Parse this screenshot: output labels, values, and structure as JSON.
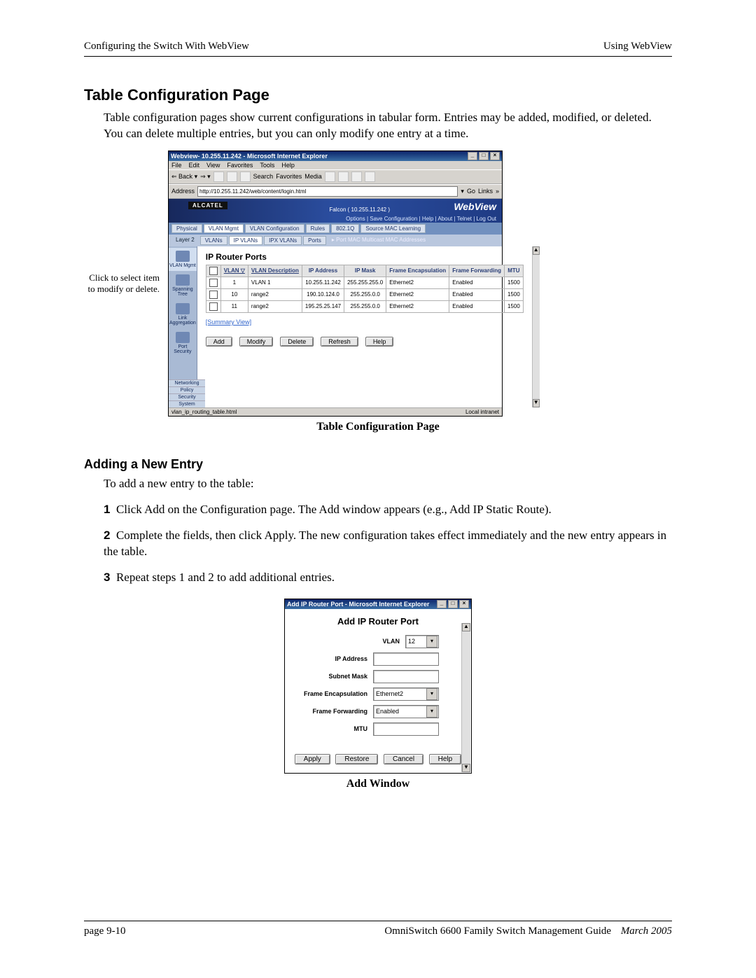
{
  "header": {
    "left": "Configuring the Switch With WebView",
    "right": "Using WebView"
  },
  "section1": {
    "title": "Table Configuration Page",
    "para": "Table configuration pages show current configurations in tabular form. Entries may be added, modified, or deleted. You can delete multiple entries, but you can only modify one entry at a time.",
    "caption": "Table Configuration Page",
    "annotation": "Click to select item to modify or delete."
  },
  "ie1": {
    "title": "Webview- 10.255.11.242 - Microsoft Internet Explorer",
    "menu": [
      "File",
      "Edit",
      "View",
      "Favorites",
      "Tools",
      "Help"
    ],
    "toolbar_back": "Back",
    "toolbar_items": [
      "Search",
      "Favorites",
      "Media"
    ],
    "address_label": "Address",
    "address_value": "http://10.255.11.242/web/content/login.html",
    "go": "Go",
    "links": "Links",
    "brand": "WebView",
    "alcatel": "ALCATEL",
    "host": "Falcon ( 10.255.11.242 )",
    "wvlinks": "Options  |  Save Configuration  |  Help  |  About  |  Telnet  |  Log Out",
    "tabs": [
      "Physical",
      "VLAN Mgmt",
      "VLAN Configuration",
      "Rules",
      "802.1Q",
      "Source MAC Learning"
    ],
    "subtabs": [
      "VLANs",
      "IP VLANs",
      "IPX VLANs",
      "Ports"
    ],
    "crumbs": "▸  Port MAC  Multicast MAC Addresses",
    "sidebar": [
      "Layer 2",
      "VLAN Mgmt",
      "Spanning Tree",
      "Link Aggregation",
      "Port Security"
    ],
    "sidebar_footer": [
      "Networking",
      "Policy",
      "Security",
      "System"
    ],
    "panel_title": "IP Router Ports",
    "columns": [
      "",
      "VLAN ▽",
      "VLAN Description",
      "IP Address",
      "IP Mask",
      "Frame Encapsulation",
      "Frame Forwarding",
      "MTU"
    ],
    "rows": [
      {
        "vlan": "1",
        "desc": "VLAN 1",
        "ip": "10.255.11.242",
        "mask": "255.255.255.0",
        "enc": "Ethernet2",
        "fwd": "Enabled",
        "mtu": "1500"
      },
      {
        "vlan": "10",
        "desc": "range2",
        "ip": "190.10.124.0",
        "mask": "255.255.0.0",
        "enc": "Ethernet2",
        "fwd": "Enabled",
        "mtu": "1500"
      },
      {
        "vlan": "11",
        "desc": "range2",
        "ip": "195.25.25.147",
        "mask": "255.255.0.0",
        "enc": "Ethernet2",
        "fwd": "Enabled",
        "mtu": "1500"
      }
    ],
    "summary_link": "[Summary View]",
    "buttons": [
      "Add",
      "Modify",
      "Delete",
      "Refresh",
      "Help"
    ],
    "status_left": "vlan_ip_routing_table.html",
    "status_right": "Local intranet"
  },
  "section2": {
    "title": "Adding a New Entry",
    "intro": "To add a new entry to the table:",
    "step1_n": "1",
    "step1": "Click Add on the Configuration page. The Add window appears (e.g., Add IP Static Route).",
    "step2_n": "2",
    "step2": "Complete the fields, then click Apply. The new configuration takes effect immediately and the new entry appears in the table.",
    "step3_n": "3",
    "step3": "Repeat steps 1 and 2 to add additional entries.",
    "caption": "Add Window"
  },
  "ie2": {
    "title": "Add IP Router Port - Microsoft Internet Explorer",
    "panel_title": "Add IP Router Port",
    "fields": {
      "vlan_label": "VLAN",
      "vlan_value": "12",
      "ip_label": "IP Address",
      "ip_value": "",
      "mask_label": "Subnet Mask",
      "mask_value": "",
      "enc_label": "Frame Encapsulation",
      "enc_value": "Ethernet2",
      "fwd_label": "Frame Forwarding",
      "fwd_value": "Enabled",
      "mtu_label": "MTU",
      "mtu_value": ""
    },
    "buttons": [
      "Apply",
      "Restore",
      "Cancel",
      "Help"
    ]
  },
  "footer": {
    "left": "page 9-10",
    "right": "OmniSwitch 6600 Family Switch Management Guide",
    "date": "March 2005"
  }
}
